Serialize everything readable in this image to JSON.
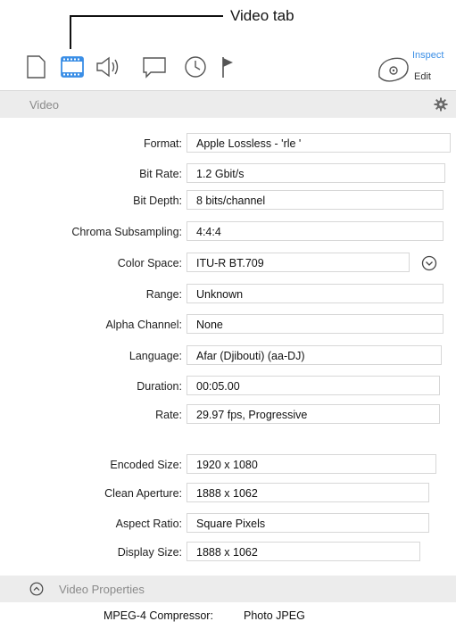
{
  "callout": {
    "label": "Video tab"
  },
  "toolbar": {
    "tabs": [
      {
        "name": "info",
        "icon": "document-icon"
      },
      {
        "name": "video",
        "icon": "film-icon",
        "active": true
      },
      {
        "name": "audio",
        "icon": "speaker-icon"
      },
      {
        "name": "captions",
        "icon": "caption-bubble-icon"
      },
      {
        "name": "timecode",
        "icon": "clock-icon"
      },
      {
        "name": "markers",
        "icon": "flag-icon"
      }
    ],
    "inspect_label": "Inspect",
    "edit_label": "Edit",
    "accent": "#3a8ee6"
  },
  "section": {
    "title": "Video"
  },
  "fields": [
    {
      "label": "Format:",
      "value": "Apple Lossless - 'rle '"
    },
    {
      "label": "Bit Rate:",
      "value": "1.2 Gbit/s"
    },
    {
      "label": "Bit Depth:",
      "value": "8 bits/channel"
    },
    {
      "label": "Chroma Subsampling:",
      "value": "4:4:4"
    },
    {
      "label": "Color Space:",
      "value": "ITU-R BT.709",
      "has_dropdown": true
    },
    {
      "label": "Range:",
      "value": "Unknown"
    },
    {
      "label": "Alpha Channel:",
      "value": "None"
    },
    {
      "label": "Language:",
      "value": "Afar (Djibouti) (aa-DJ)"
    },
    {
      "label": "Duration:",
      "value": "00:05.00"
    },
    {
      "label": "Rate:",
      "value": "29.97 fps, Progressive"
    },
    {
      "label": "Encoded Size:",
      "value": "1920 x 1080"
    },
    {
      "label": "Clean Aperture:",
      "value": "1888 x 1062"
    },
    {
      "label": "Aspect Ratio:",
      "value": "Square Pixels"
    },
    {
      "label": "Display Size:",
      "value": "1888 x 1062"
    }
  ],
  "properties": {
    "title": "Video Properties",
    "items": [
      {
        "key": "MPEG-4 Compressor:",
        "value": "Photo JPEG"
      }
    ]
  }
}
